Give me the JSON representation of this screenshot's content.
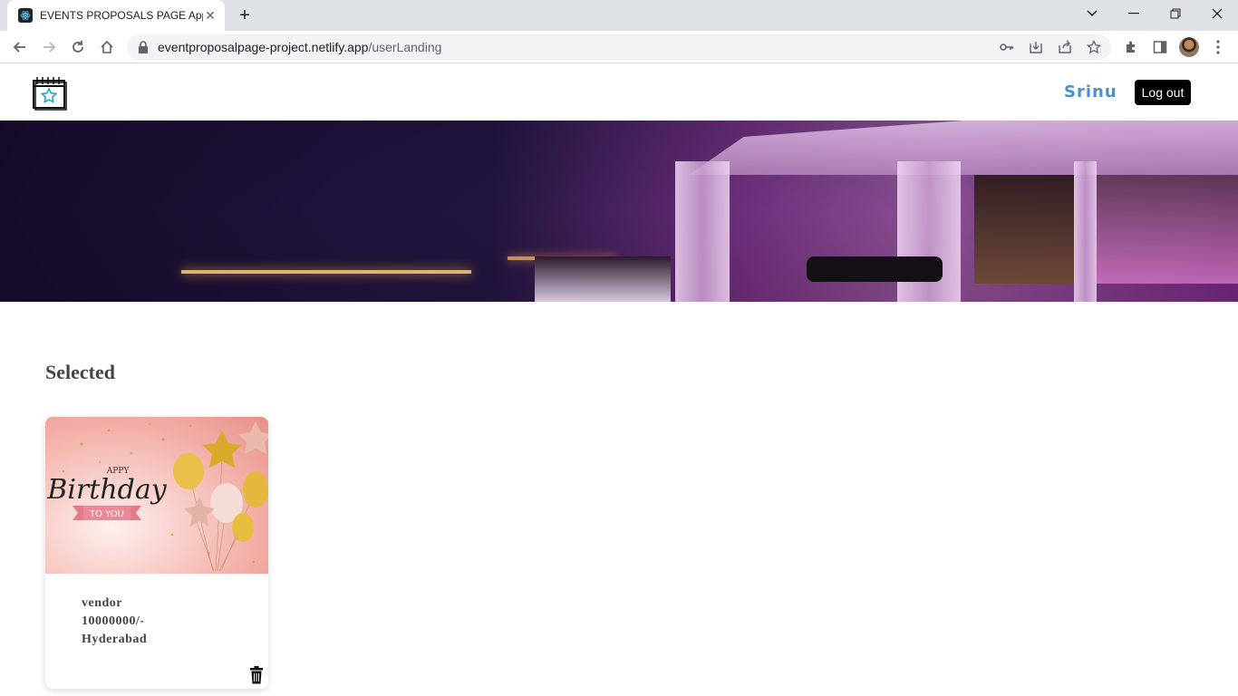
{
  "browser": {
    "tab_title": "EVENTS PROPOSALS PAGE App",
    "url_host": "eventproposalpage-project.netlify.app",
    "url_path": "/userLanding"
  },
  "header": {
    "username": "Srinu",
    "logout_label": "Log out"
  },
  "main": {
    "section_title": "Selected",
    "cards": [
      {
        "image_text_top": "APPY",
        "image_text_main": "Birthday",
        "image_text_ribbon": "TO YOU",
        "vendor": "vendor",
        "price": "10000000/-",
        "location": "Hyderabad"
      }
    ]
  },
  "colors": {
    "username": "#4a90d9",
    "logout_bg": "#000000",
    "title_text": "#444444"
  }
}
